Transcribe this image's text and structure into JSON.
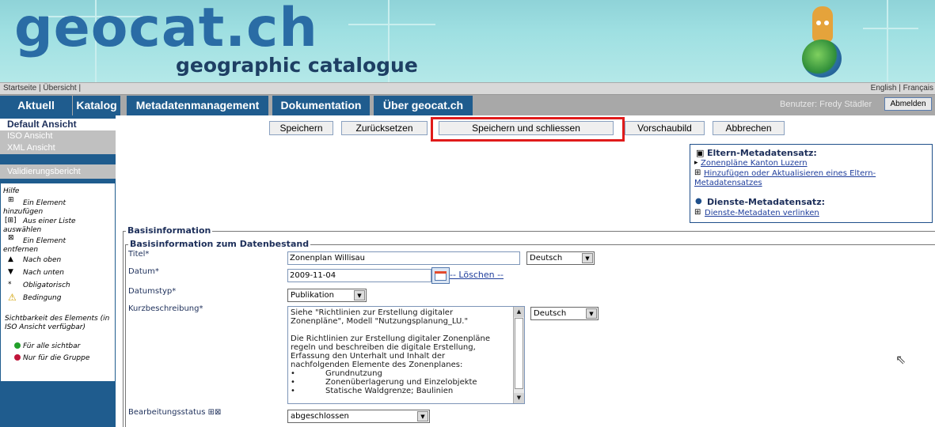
{
  "banner": {
    "logo_text": "geocat.ch",
    "subtitle": "geographic catalogue"
  },
  "toplinks": {
    "left": [
      "Startseite",
      "Übersicht"
    ],
    "right": [
      "English",
      "Français"
    ],
    "sep": "|"
  },
  "nav": {
    "items": [
      "Aktuell",
      "Katalog",
      "Metadatenmanagement",
      "Dokumentation",
      "Über geocat.ch"
    ],
    "user": "Benutzer: Fredy Städler",
    "logout": "Abmelden"
  },
  "sidebar": {
    "views": [
      "Default Ansicht",
      "ISO Ansicht",
      "XML Ansicht"
    ],
    "validation": "Validierungsbericht",
    "help": {
      "title": "Hilfe",
      "items": [
        {
          "icon": "⊞",
          "text": "Ein Element",
          "text2": "hinzufügen"
        },
        {
          "icon": "[⊞]",
          "text": "Aus einer Liste",
          "text2": "auswählen"
        },
        {
          "icon": "⊠",
          "text": "Ein Element",
          "text2": "entfernen"
        },
        {
          "icon": "▲",
          "text": "Nach oben"
        },
        {
          "icon": "▼",
          "text": "Nach unten"
        },
        {
          "icon": "*",
          "text": "Obligatorisch"
        },
        {
          "icon": "⚠",
          "text": "Bedingung"
        }
      ],
      "visibility_title": "Sichtbarkeit des Elements (in ISO Ansicht verfügbar)",
      "vis1": "Für alle sichtbar",
      "vis2": "Nur für die Gruppe",
      "colors": {
        "green": "#22a02a",
        "red": "#c0153a"
      }
    }
  },
  "actions": {
    "save": "Speichern",
    "reset": "Zurücksetzen",
    "save_close": "Speichern und schliessen",
    "preview": "Vorschaubild",
    "cancel": "Abbrechen"
  },
  "parent_box": {
    "title": "Eltern-Metadatensatz:",
    "link1": "Zonenpläne Kanton Luzern",
    "link2": "Hinzufügen oder Aktualisieren eines Eltern-Metadatensatzes",
    "service_title": "Dienste-Metadatensatz:",
    "service_link": "Dienste-Metadaten verlinken"
  },
  "form": {
    "section": "Basisinformation",
    "subsection": "Basisinformation zum Datenbestand",
    "title_label": "Titel*",
    "title_value": "Zonenplan Willisau",
    "title_lang": "Deutsch",
    "date_label": "Datum*",
    "date_value": "2009-11-04",
    "date_delete": "-- Löschen --",
    "datetype_label": "Datumstyp*",
    "datetype_value": "Publikation",
    "abstract_label": "Kurzbeschreibung*",
    "abstract_lang": "Deutsch",
    "abstract_lines": [
      "Siehe \"Richtlinien zur Erstellung digitaler",
      "Zonenpläne\", Modell \"Nutzungsplanung_LU.\"",
      "",
      "Die Richtlinien zur Erstellung digitaler Zonenpläne",
      "regeln und beschreiben die digitale Erstellung,",
      "Erfassung den Unterhalt und Inhalt der",
      "nachfolgenden Elemente des Zonenplanes:",
      "•            Grundnutzung",
      "•            Zonenüberlagerung und Einzelobjekte",
      "•            Statische Waldgrenze; Baulinien"
    ],
    "status_label": "Bearbeitungsstatus",
    "status_value": "abgeschlossen"
  }
}
